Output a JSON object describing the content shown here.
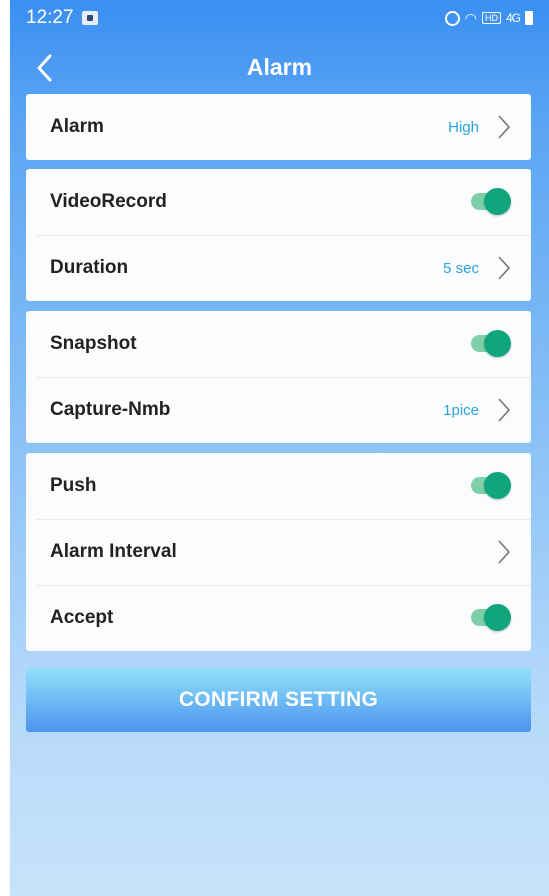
{
  "status_bar": {
    "time": "12:27",
    "icons": [
      "alarm-icon",
      "wifi-icon",
      "hd-icon",
      "signal-4g-icon",
      "battery-icon"
    ],
    "hd_label": "HD",
    "signal_label": "4G"
  },
  "header": {
    "title": "Alarm",
    "back_icon": "chevron-left-icon"
  },
  "groups": [
    {
      "rows": [
        {
          "label": "Alarm",
          "value": "High",
          "control": "chevron"
        }
      ]
    },
    {
      "rows": [
        {
          "label": "VideoRecord",
          "control": "toggle",
          "on": true
        },
        {
          "label": "Duration",
          "value": "5 sec",
          "control": "chevron"
        }
      ]
    },
    {
      "rows": [
        {
          "label": "Snapshot",
          "control": "toggle",
          "on": true
        },
        {
          "label": "Capture-Nmb",
          "value": "1pice",
          "control": "chevron"
        }
      ]
    },
    {
      "rows": [
        {
          "label": "Push",
          "control": "toggle",
          "on": true
        },
        {
          "label": "Alarm Interval",
          "value": "",
          "control": "chevron"
        },
        {
          "label": "Accept",
          "control": "toggle",
          "on": true
        }
      ]
    }
  ],
  "confirm_button": {
    "label": "CONFIRM SETTING"
  },
  "colors": {
    "accent_value": "#2aa4e0",
    "toggle_on": "#10a67d",
    "header_blue": "#3a8ff2"
  }
}
